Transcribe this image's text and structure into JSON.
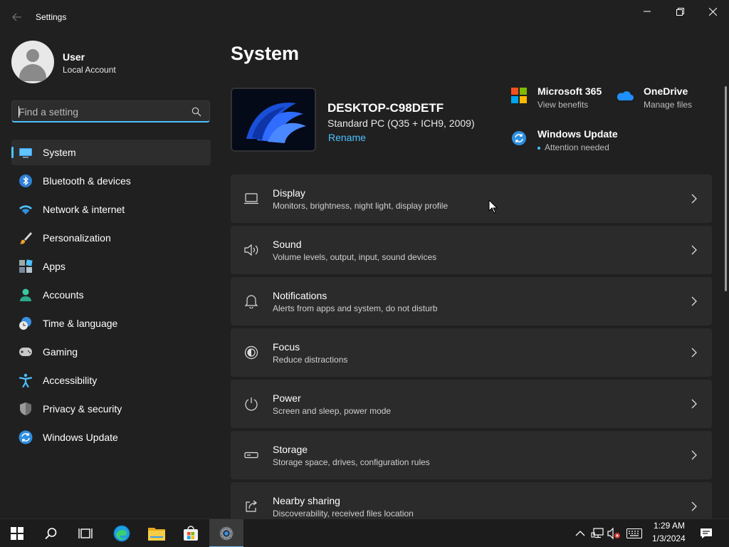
{
  "window": {
    "title": "Settings"
  },
  "profile": {
    "name": "User",
    "account_type": "Local Account"
  },
  "search": {
    "placeholder": "Find a setting",
    "value": ""
  },
  "sidebar": {
    "items": [
      {
        "label": "System",
        "icon": "system-icon",
        "active": true
      },
      {
        "label": "Bluetooth & devices",
        "icon": "bluetooth-icon"
      },
      {
        "label": "Network & internet",
        "icon": "wifi-icon"
      },
      {
        "label": "Personalization",
        "icon": "brush-icon"
      },
      {
        "label": "Apps",
        "icon": "apps-icon"
      },
      {
        "label": "Accounts",
        "icon": "person-icon"
      },
      {
        "label": "Time & language",
        "icon": "clock-globe-icon"
      },
      {
        "label": "Gaming",
        "icon": "gamepad-icon"
      },
      {
        "label": "Accessibility",
        "icon": "accessibility-icon"
      },
      {
        "label": "Privacy & security",
        "icon": "shield-icon"
      },
      {
        "label": "Windows Update",
        "icon": "update-icon"
      }
    ]
  },
  "main": {
    "title": "System",
    "device": {
      "name": "DESKTOP-C98DETF",
      "model": "Standard PC (Q35 + ICH9, 2009)",
      "rename_label": "Rename"
    },
    "quick_links": [
      {
        "title": "Microsoft 365",
        "subtitle": "View benefits",
        "icon": "microsoft-logo-icon"
      },
      {
        "title": "OneDrive",
        "subtitle": "Manage files",
        "icon": "cloud-icon"
      },
      {
        "title": "Windows Update",
        "subtitle": "Attention needed",
        "icon": "update-icon"
      }
    ],
    "cards": [
      {
        "title": "Display",
        "subtitle": "Monitors, brightness, night light, display profile",
        "icon": "display-icon"
      },
      {
        "title": "Sound",
        "subtitle": "Volume levels, output, input, sound devices",
        "icon": "speaker-icon"
      },
      {
        "title": "Notifications",
        "subtitle": "Alerts from apps and system, do not disturb",
        "icon": "bell-icon"
      },
      {
        "title": "Focus",
        "subtitle": "Reduce distractions",
        "icon": "focus-icon"
      },
      {
        "title": "Power",
        "subtitle": "Screen and sleep, power mode",
        "icon": "power-icon"
      },
      {
        "title": "Storage",
        "subtitle": "Storage space, drives, configuration rules",
        "icon": "storage-icon"
      },
      {
        "title": "Nearby sharing",
        "subtitle": "Discoverability, received files location",
        "icon": "share-icon"
      }
    ]
  },
  "taskbar": {
    "time": "1:29 AM",
    "date": "1/3/2024"
  },
  "colors": {
    "accent": "#4cc2ff",
    "background": "#202020",
    "card": "#2b2b2b",
    "taskbar": "#1c1c1c"
  }
}
